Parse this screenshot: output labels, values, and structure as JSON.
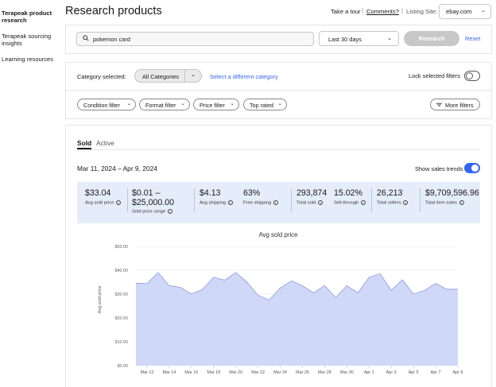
{
  "sidebar": {
    "items": [
      {
        "label": "Terapeak product research",
        "active": true
      },
      {
        "label": "Terapeak sourcing insights",
        "active": false
      },
      {
        "label": "Learning resources",
        "active": false
      }
    ]
  },
  "header": {
    "title": "Research products",
    "take_tour": "Take a tour",
    "comments": "Comments?",
    "listing_site_label": "Listing Site:",
    "listing_site_value": "ebay.com"
  },
  "search": {
    "query": "pokemon card",
    "date_range": "Last 30 days",
    "research_label": "Research",
    "reset_label": "Reset"
  },
  "filters": {
    "category_label": "Category selected:",
    "category_value": "All Categories",
    "select_category_link": "Select a different category",
    "lock_label": "Lock selected filters",
    "chips": [
      "Condition filter",
      "Format filter",
      "Price filter",
      "Top rated"
    ],
    "more_filters": "More filters"
  },
  "results": {
    "tabs": [
      "Sold",
      "Active"
    ],
    "date_range": "Mar 11, 2024 – Apr 9, 2024",
    "trends_label": "Show sales trends",
    "stats": [
      {
        "value": "$33.04",
        "label": "Avg sold price"
      },
      {
        "value": "$0.01 – $25,000.00",
        "label": "Sold price range"
      },
      {
        "value": "$4.13",
        "label": "Avg shipping"
      },
      {
        "value": "63%",
        "label": "Free shipping"
      },
      {
        "value": "293,874",
        "label": "Total sold"
      },
      {
        "value": "15.02%",
        "label": "Sell-through"
      },
      {
        "value": "26,213",
        "label": "Total sellers"
      },
      {
        "value": "$9,709,596.96",
        "label": "Total item sales"
      }
    ]
  },
  "colors": {
    "accent": "#3665f3",
    "area_fill": "#cfd8f7",
    "area_line": "#93a3e6",
    "stats_bg": "#e5edfa"
  },
  "chart_data": {
    "type": "area",
    "title": "Avg sold price",
    "xlabel": "",
    "ylabel": "Avg sold price",
    "ylim": [
      0,
      50
    ],
    "yticks": [
      "$0.00",
      "$10.00",
      "$20.00",
      "$30.00",
      "$40.00",
      "$50.00"
    ],
    "xticks": [
      "Mar 12",
      "Mar 14",
      "Mar 16",
      "Mar 18",
      "Mar 20",
      "Mar 22",
      "Mar 24",
      "Mar 26",
      "Mar 28",
      "Mar 30",
      "Apr 1",
      "Apr 3",
      "Apr 5",
      "Apr 7",
      "Apr 9"
    ],
    "grid": true,
    "series": [
      {
        "x": [
          "Mar 11",
          "Mar 12",
          "Mar 13",
          "Mar 14",
          "Mar 15",
          "Mar 16",
          "Mar 17",
          "Mar 18",
          "Mar 19",
          "Mar 20",
          "Mar 21",
          "Mar 22",
          "Mar 23",
          "Mar 24",
          "Mar 25",
          "Mar 26",
          "Mar 27",
          "Mar 28",
          "Mar 29",
          "Mar 30",
          "Mar 31",
          "Apr 1",
          "Apr 2",
          "Apr 3",
          "Apr 4",
          "Apr 5",
          "Apr 6",
          "Apr 7",
          "Apr 8",
          "Apr 9"
        ],
        "values": [
          34.5,
          34.4,
          39,
          33.5,
          32.8,
          30,
          32,
          37,
          35.8,
          39,
          35,
          29.5,
          27.5,
          32.5,
          35.5,
          33.5,
          30.5,
          33.5,
          28.5,
          33.5,
          30.5,
          37,
          38.5,
          31.5,
          36,
          30,
          31.5,
          34.5,
          32,
          32
        ]
      }
    ]
  }
}
